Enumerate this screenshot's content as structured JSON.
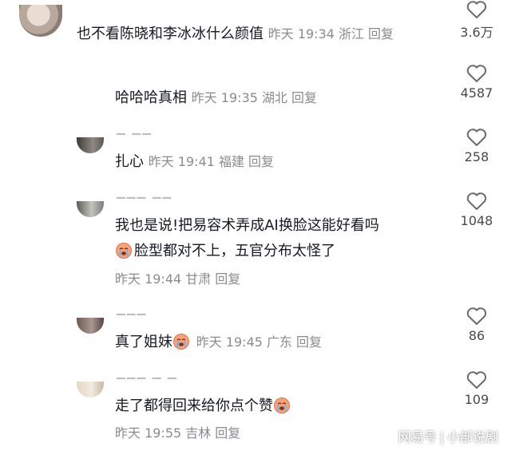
{
  "comments": [
    {
      "text": "也不看陈晓和李冰冰什么颜值",
      "time": "昨天 19:34",
      "location": "浙江",
      "reply": "回复",
      "likes": "3.6万"
    },
    {
      "text": "哈哈哈真相",
      "time": "昨天 19:35",
      "location": "湖北",
      "reply": "回复",
      "likes": "4587"
    },
    {
      "text": "扎心",
      "time": "昨天 19:41",
      "location": "福建",
      "reply": "回复",
      "likes": "258"
    },
    {
      "text_line1": "我也是说!把易容术弄成AI换脸这能好看吗",
      "text_line2": "脸型都对不上，五官分布太怪了",
      "emoji": "crying-face",
      "time": "昨天 19:44",
      "location": "甘肃",
      "reply": "回复",
      "likes": "1048"
    },
    {
      "text": "真了姐妹",
      "emoji": "crying-face",
      "time": "昨天 19:45",
      "location": "广东",
      "reply": "回复",
      "likes": "86"
    },
    {
      "text": "走了都得回来给你点个赞",
      "emoji": "crying-face",
      "time": "昨天 19:55",
      "location": "吉林",
      "reply": "回复",
      "likes": "109"
    }
  ],
  "watermark": {
    "left": "网易号",
    "separator": "|",
    "right": "小部说剧"
  },
  "icons": {
    "like": "heart-outline-icon",
    "emoji": "crying-face-emoji"
  },
  "colors": {
    "text": "#161823",
    "meta": "#8a8b91",
    "emoji": "#f6a27a"
  }
}
